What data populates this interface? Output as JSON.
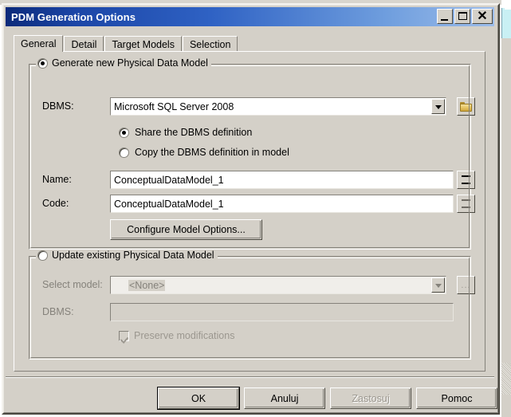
{
  "window": {
    "title": "PDM Generation Options",
    "minimize_label": "Minimize",
    "maximize_label": "Maximize",
    "close_label": "Close",
    "close_glyph": "✕"
  },
  "tabs": [
    {
      "label": "General",
      "active": true
    },
    {
      "label": "Detail",
      "active": false
    },
    {
      "label": "Target Models",
      "active": false
    },
    {
      "label": "Selection",
      "active": false
    }
  ],
  "generate_group": {
    "legend": "Generate new Physical Data Model",
    "selected": true,
    "dbms_label": "DBMS:",
    "dbms_value": "Microsoft SQL Server 2008",
    "dbms_browse_icon": "folder-icon",
    "share_option": "Share the DBMS definition",
    "share_selected": true,
    "copy_option": "Copy the DBMS definition in model",
    "copy_selected": false,
    "name_label": "Name:",
    "name_value": "ConceptualDataModel_1",
    "code_label": "Code:",
    "code_value": "ConceptualDataModel_1",
    "equals_button_label": "=",
    "configure_button": "Configure Model Options..."
  },
  "update_group": {
    "legend": "Update existing Physical Data Model",
    "selected": false,
    "select_model_label": "Select model:",
    "select_model_value": "<None>",
    "browse_button_label": "...",
    "dbms_label": "DBMS:",
    "dbms_value": "",
    "preserve_label": "Preserve modifications",
    "preserve_checked": true
  },
  "footer": {
    "buttons": [
      {
        "label": "OK",
        "default": true,
        "disabled": false
      },
      {
        "label": "Anuluj",
        "default": false,
        "disabled": false
      },
      {
        "label": "Zastosuj",
        "default": false,
        "disabled": true
      },
      {
        "label": "Pomoc",
        "default": false,
        "disabled": false
      }
    ]
  },
  "colors": {
    "dialog_face": "#d4d0c8",
    "title_start": "#0b2a7a",
    "title_end": "#9dbdea",
    "text": "#000000",
    "disabled_text": "#85827b",
    "field_bg": "#ffffff"
  }
}
